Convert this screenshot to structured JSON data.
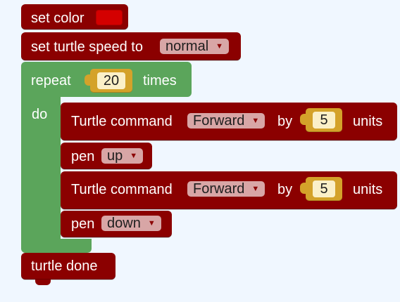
{
  "blocks": {
    "set_color": {
      "label": "set color",
      "color": "#d40000"
    },
    "set_speed": {
      "label": "set turtle speed to",
      "value": "normal"
    },
    "repeat": {
      "label": "repeat",
      "count": "20",
      "times": "times",
      "do": "do"
    },
    "cmd1": {
      "label": "Turtle command",
      "command": "Forward",
      "by": "by",
      "amount": "5",
      "units": "units"
    },
    "pen1": {
      "label": "pen",
      "value": "up"
    },
    "cmd2": {
      "label": "Turtle command",
      "command": "Forward",
      "by": "by",
      "amount": "5",
      "units": "units"
    },
    "pen2": {
      "label": "pen",
      "value": "down"
    },
    "done": {
      "label": "turtle done"
    }
  },
  "colors": {
    "turtle_block": "#8b0000",
    "loop_block": "#5ba55b",
    "number_piece": "#d4a22a",
    "workspace": "#f0f7ff"
  },
  "icons": {
    "dropdown": "▼"
  }
}
